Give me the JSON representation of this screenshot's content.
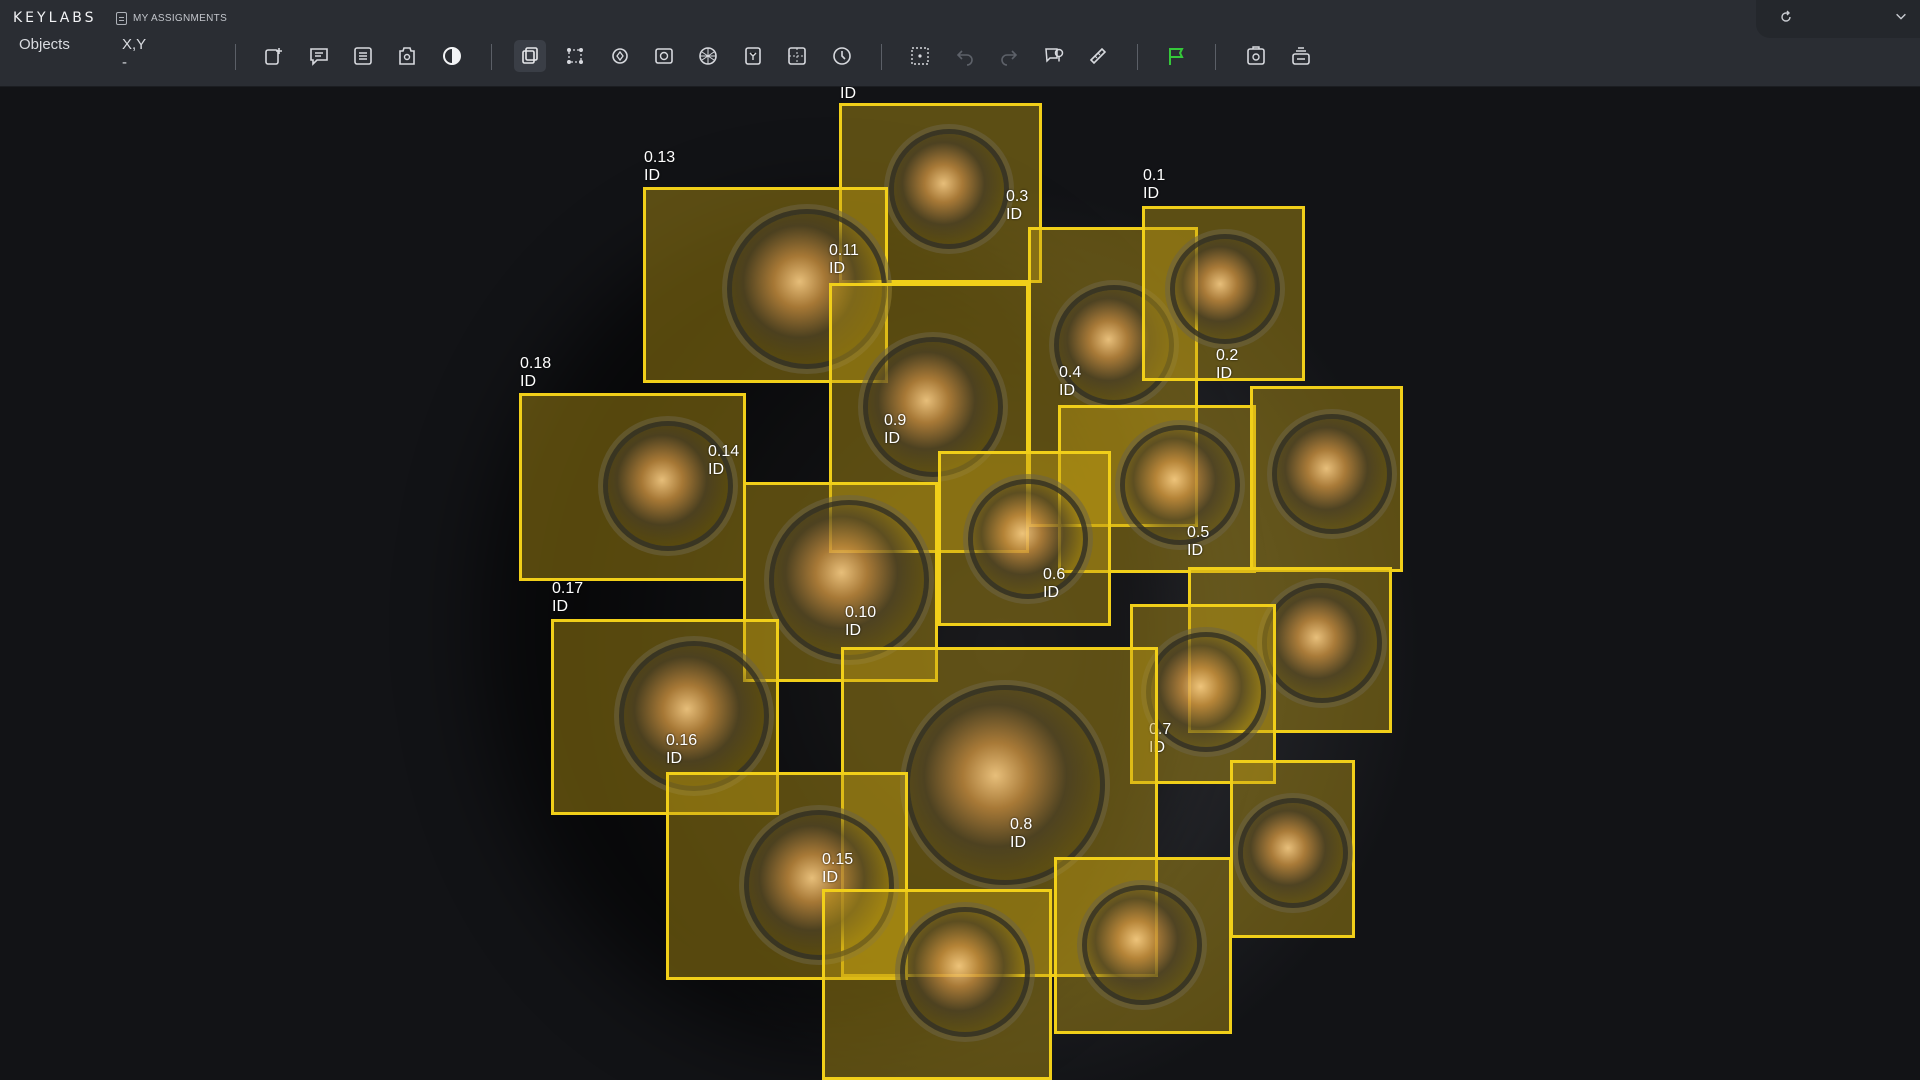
{
  "app": {
    "brand": "KEYLABS",
    "assignments_label": "MY ASSIGNMENTS"
  },
  "header": {
    "objects_tab": "Objects",
    "xy_label": "X,Y",
    "xy_value": "-"
  },
  "toolbar": {
    "icons": [
      "new-object-icon",
      "comment-icon",
      "list-icon",
      "tag-lock-icon",
      "contrast-icon",
      "bounding-box-tool-icon",
      "polygon-tool-icon",
      "magic-wand-icon",
      "segment-icon",
      "mask-icon",
      "auto-label-icon",
      "grid-icon",
      "history-icon",
      "select-area-icon",
      "undo-icon",
      "redo-icon",
      "location-review-icon",
      "ruler-icon",
      "flag-icon",
      "screenshot-icon",
      "stack-icon"
    ],
    "flag_color": "#35c83a"
  },
  "annotation": {
    "box_color": "#f1cf19",
    "id_text": "ID",
    "boxes": [
      {
        "name": "0.1"
      },
      {
        "name": "0.2"
      },
      {
        "name": "0.3"
      },
      {
        "name": "0.4"
      },
      {
        "name": "0.5"
      },
      {
        "name": "0.6"
      },
      {
        "name": "0.7"
      },
      {
        "name": "0.8"
      },
      {
        "name": "0.9"
      },
      {
        "name": "0.10"
      },
      {
        "name": "0.11"
      },
      {
        "name": "0.13"
      },
      {
        "name": "0.14"
      },
      {
        "name": "0.15"
      },
      {
        "name": "0.16"
      },
      {
        "name": "0.17"
      },
      {
        "name": "0.18"
      }
    ]
  }
}
